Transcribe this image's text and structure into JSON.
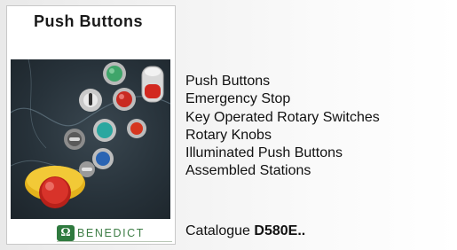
{
  "card": {
    "title": "Push Buttons"
  },
  "brand": {
    "logo_text": "BENEDICT",
    "logo_mark": "Ω",
    "brand_color": "#2f7a3f"
  },
  "product_list": [
    "Push Buttons",
    "Emergency Stop",
    "Key Operated Rotary Switches",
    "Rotary Knobs",
    "Illuminated Push Buttons",
    "Assembled Stations"
  ],
  "catalogue": {
    "label": "Catalogue",
    "code": "D580E.."
  },
  "photo": {
    "icons": [
      "green-push-button-icon",
      "red-push-button-icon",
      "key-switch-icon",
      "rotary-knob-icon",
      "blue-push-button-icon",
      "emergency-stop-icon",
      "illuminated-button-icon"
    ]
  }
}
